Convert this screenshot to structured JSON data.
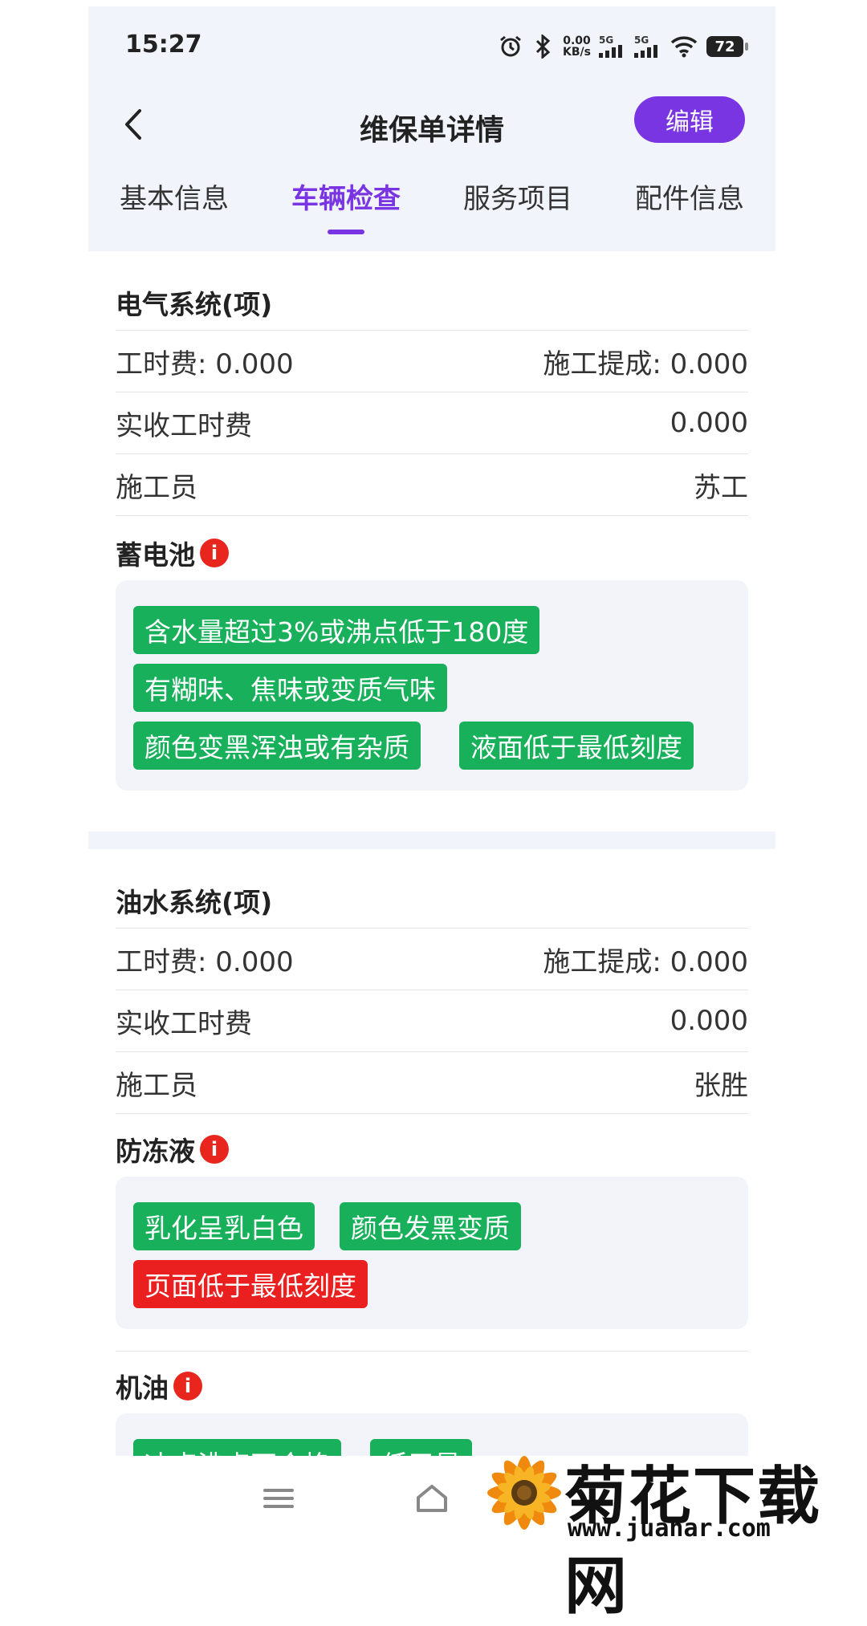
{
  "status_bar": {
    "time": "15:27",
    "net_speed_value": "0.00",
    "net_speed_unit": "KB/s",
    "signal1_label": "5G",
    "signal2_label": "5G",
    "battery": "72"
  },
  "header": {
    "title": "维保单详情",
    "edit_label": "编辑"
  },
  "tabs": [
    {
      "label": "基本信息",
      "active": false
    },
    {
      "label": "车辆检查",
      "active": true
    },
    {
      "label": "服务项目",
      "active": false
    },
    {
      "label": "配件信息",
      "active": false
    }
  ],
  "sections": [
    {
      "title": "电气系统(项)",
      "labor_fee_label": "工时费: 0.000",
      "commission_label": "施工提成: 0.000",
      "actual_fee_label": "实收工时费",
      "actual_fee_value": "0.000",
      "worker_label": "施工员",
      "worker_value": "苏工",
      "checks": [
        {
          "name": "蓄电池",
          "info_icon": "i",
          "tags": [
            {
              "text": "含水量超过3%或沸点低于180度",
              "color": "green"
            },
            {
              "text": "有糊味、焦味或变质气味",
              "color": "green"
            },
            {
              "text": "颜色变黑浑浊或有杂质",
              "color": "green"
            },
            {
              "text": "液面低于最低刻度",
              "color": "green"
            }
          ]
        }
      ]
    },
    {
      "title": "油水系统(项)",
      "labor_fee_label": "工时费: 0.000",
      "commission_label": "施工提成: 0.000",
      "actual_fee_label": "实收工时费",
      "actual_fee_value": "0.000",
      "worker_label": "施工员",
      "worker_value": "张胜",
      "checks": [
        {
          "name": "防冻液",
          "info_icon": "i",
          "tags": [
            {
              "text": "乳化呈乳白色",
              "color": "green"
            },
            {
              "text": "颜色发黑变质",
              "color": "green"
            },
            {
              "text": "页面低于最低刻度",
              "color": "red"
            }
          ]
        },
        {
          "name": "机油",
          "info_icon": "i",
          "tags": [
            {
              "text": "冰点沸点不合格",
              "color": "green"
            },
            {
              "text": "低于最",
              "color": "green"
            }
          ]
        }
      ]
    }
  ],
  "bottom_nav": {
    "menu_icon": "menu-icon",
    "home_icon": "home-icon"
  },
  "watermark": {
    "title": "菊花下载网",
    "url": "www.juahar.com"
  },
  "colors": {
    "accent": "#7a35e2",
    "tag_green": "#18b05b",
    "tag_red": "#ea2020",
    "header_bg": "#f2f4fc"
  }
}
